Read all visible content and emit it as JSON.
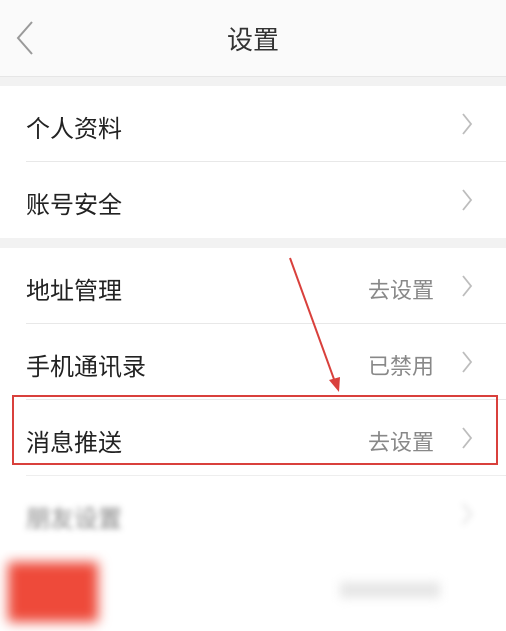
{
  "header": {
    "title": "设置",
    "back_icon": "chevron-left-icon"
  },
  "group1": [
    {
      "label": "个人资料"
    },
    {
      "label": "账号安全"
    }
  ],
  "group2": [
    {
      "label": "地址管理",
      "value": "去设置"
    },
    {
      "label": "手机通讯录",
      "value": "已禁用"
    },
    {
      "label": "消息推送",
      "value": "去设置"
    },
    {
      "label": "朋友设置"
    }
  ],
  "colors": {
    "highlight": "#d9403c",
    "background": "#f2f2f2"
  }
}
